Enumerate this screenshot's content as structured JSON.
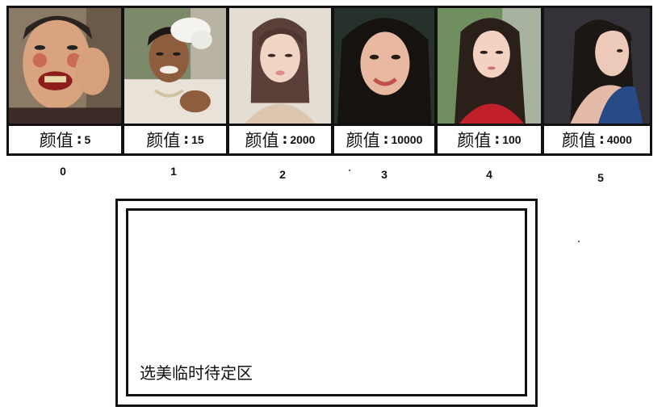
{
  "cards": [
    {
      "index": "0",
      "label_prefix": "颜值",
      "label_colon": ":",
      "value": "5",
      "photo": "portrait-photo-man-clown-makeup"
    },
    {
      "index": "1",
      "label_prefix": "颜值",
      "label_colon": ":",
      "value": "15",
      "photo": "portrait-photo-bride-white-headpiece"
    },
    {
      "index": "2",
      "label_prefix": "颜值",
      "label_colon": ":",
      "value": "2000",
      "photo": "portrait-photo-woman-light-background"
    },
    {
      "index": "3",
      "label_prefix": "颜值",
      "label_colon": ":",
      "value": "10000",
      "photo": "portrait-photo-woman-smiling-dark-hair"
    },
    {
      "index": "4",
      "label_prefix": "颜值",
      "label_colon": ":",
      "value": "100",
      "photo": "portrait-photo-woman-red-top"
    },
    {
      "index": "5",
      "label_prefix": "颜值",
      "label_colon": ":",
      "value": "4000",
      "photo": "portrait-photo-woman-blue-dress-profile"
    }
  ],
  "staging_area": {
    "label": "选美临时待定区"
  },
  "colors": {
    "border": "#111111",
    "background": "#ffffff"
  }
}
